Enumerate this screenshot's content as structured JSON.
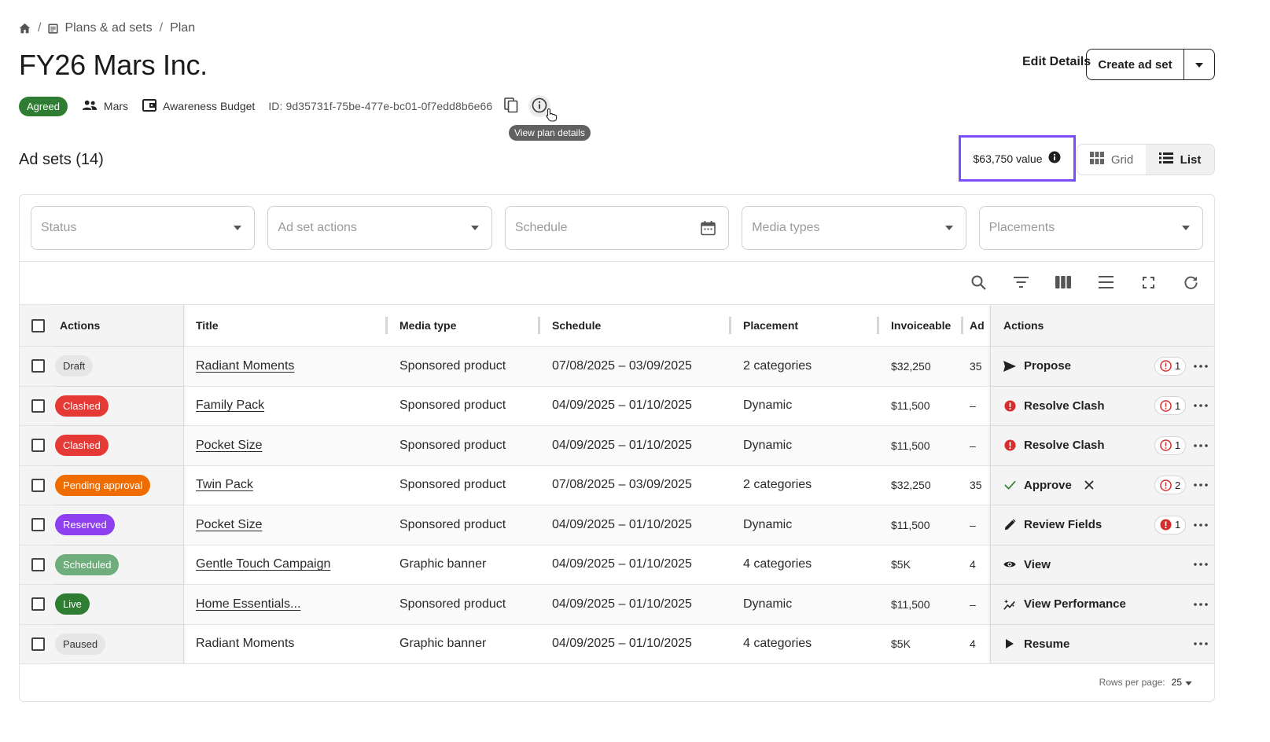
{
  "breadcrumb": {
    "section": "Plans & ad sets",
    "current": "Plan",
    "sep": "/"
  },
  "page": {
    "title": "FY26 Mars Inc."
  },
  "header_actions": {
    "edit_details": "Edit Details",
    "create_ad_set": "Create ad set"
  },
  "meta": {
    "status": "Agreed",
    "advertiser": "Mars",
    "budget": "Awareness Budget",
    "id": "ID: 9d35731f-75be-477e-bc01-0f7edd8b6e66",
    "tooltip": "View plan details"
  },
  "ad_sets": {
    "heading": "Ad sets (14)",
    "value": "$63,750 value",
    "view_grid": "Grid",
    "view_list": "List",
    "selected_view": "List"
  },
  "filters": [
    {
      "placeholder": "Status",
      "icon": "chevron-down-icon"
    },
    {
      "placeholder": "Ad set actions",
      "icon": "chevron-down-icon"
    },
    {
      "placeholder": "Schedule",
      "icon": "calendar-icon"
    },
    {
      "placeholder": "Media types",
      "icon": "chevron-down-icon"
    },
    {
      "placeholder": "Placements",
      "icon": "chevron-down-icon"
    }
  ],
  "table": {
    "headers": {
      "actions_left": "Actions",
      "title": "Title",
      "media": "Media type",
      "schedule": "Schedule",
      "placement": "Placement",
      "invoiceable": "Invoiceable",
      "ad": "Ad",
      "actions_right": "Actions"
    },
    "rows": [
      {
        "status": "Draft",
        "status_bg": "#e6e6e6",
        "status_fg": "#333333",
        "title": "Radiant Moments",
        "linked": true,
        "media": "Sponsored product",
        "schedule": "07/08/2025 – 03/09/2025",
        "placement": "2 categories",
        "invoiceable": "$32,250",
        "ad": "35",
        "action": "Propose",
        "action_icon": "send-icon",
        "errors": "1",
        "error_style": "outline"
      },
      {
        "status": "Clashed",
        "status_bg": "#e53935",
        "status_fg": "#ffffff",
        "title": "Family Pack",
        "linked": true,
        "media": "Sponsored product",
        "schedule": "04/09/2025 – 01/10/2025",
        "placement": "Dynamic",
        "invoiceable": "$11,500",
        "ad": "–",
        "action": "Resolve Clash",
        "action_icon": "alert-icon",
        "errors": "1",
        "error_style": "outline"
      },
      {
        "status": "Clashed",
        "status_bg": "#e53935",
        "status_fg": "#ffffff",
        "title": "Pocket Size",
        "linked": true,
        "media": "Sponsored product",
        "schedule": "04/09/2025 – 01/10/2025",
        "placement": "Dynamic",
        "invoiceable": "$11,500",
        "ad": "–",
        "action": "Resolve Clash",
        "action_icon": "alert-icon",
        "errors": "1",
        "error_style": "outline"
      },
      {
        "status": "Pending approval",
        "status_bg": "#ef6c00",
        "status_fg": "#ffffff",
        "title": "Twin Pack",
        "linked": true,
        "media": "Sponsored product",
        "schedule": "07/08/2025 – 03/09/2025",
        "placement": "2 categories",
        "invoiceable": "$32,250",
        "ad": "35",
        "action": "Approve",
        "action_icon": "check-icon",
        "reject": true,
        "errors": "2",
        "error_style": "outline"
      },
      {
        "status": "Reserved",
        "status_bg": "#8e3ff0",
        "status_fg": "#ffffff",
        "title": "Pocket Size",
        "linked": true,
        "media": "Sponsored product",
        "schedule": "04/09/2025 – 01/10/2025",
        "placement": "Dynamic",
        "invoiceable": "$11,500",
        "ad": "–",
        "action": "Review Fields",
        "action_icon": "pencil-icon",
        "errors": "1",
        "error_style": "filled"
      },
      {
        "status": "Scheduled",
        "status_bg": "#6fae7c",
        "status_fg": "#ffffff",
        "title": "Gentle Touch Campaign",
        "linked": true,
        "media": "Graphic banner",
        "schedule": "04/09/2025 – 01/10/2025",
        "placement": "4 categories",
        "invoiceable": "$5K",
        "ad": "4",
        "action": "View",
        "action_icon": "eye-icon",
        "errors": "",
        "error_style": ""
      },
      {
        "status": "Live",
        "status_bg": "#2e7d32",
        "status_fg": "#ffffff",
        "title": "Home Essentials...",
        "linked": true,
        "media": "Sponsored product",
        "schedule": "04/09/2025 – 01/10/2025",
        "placement": "Dynamic",
        "invoiceable": "$11,500",
        "ad": "–",
        "action": "View Performance",
        "action_icon": "sparkle-chart-icon",
        "errors": "",
        "error_style": ""
      },
      {
        "status": "Paused",
        "status_bg": "#e6e6e6",
        "status_fg": "#333333",
        "title": "Radiant Moments",
        "linked": false,
        "media": "Graphic banner",
        "schedule": "04/09/2025 – 01/10/2025",
        "placement": "4 categories",
        "invoiceable": "$5K",
        "ad": "4",
        "action": "Resume",
        "action_icon": "play-icon",
        "errors": "",
        "error_style": ""
      }
    ]
  },
  "footer": {
    "rows_per_page_label": "Rows per page:",
    "rows_per_page": "25"
  },
  "colors": {
    "accent_highlight": "#7b4dff",
    "error": "#d32f2f",
    "success": "#2e7d32"
  }
}
